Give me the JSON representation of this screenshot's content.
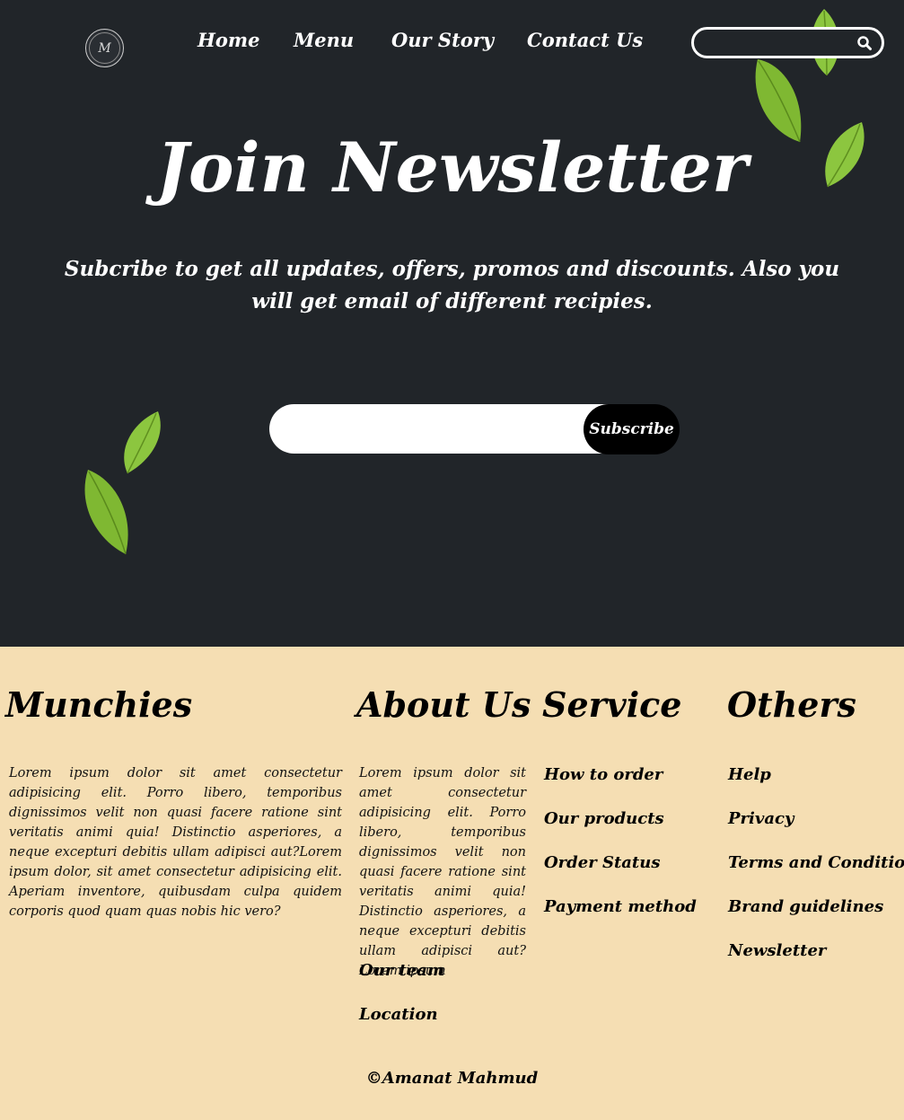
{
  "nav": {
    "logo_text": "M",
    "items": [
      {
        "label": "Home"
      },
      {
        "label": "Menu"
      },
      {
        "label": "Our Story"
      },
      {
        "label": "Contact Us"
      }
    ],
    "search_placeholder": ""
  },
  "hero": {
    "title": "Join Newsletter",
    "subtitle": "Subcribe to get all updates, offers, promos and discounts. Also you will get email of different recipies.",
    "email_placeholder": "",
    "subscribe_label": "Subscribe"
  },
  "footer": {
    "columns": [
      {
        "title": "Munchies",
        "text": "Lorem ipsum dolor sit amet consectetur adipisicing elit. Porro libero, temporibus dignissimos velit non quasi facere ratione sint veritatis animi quia! Distinctio asperiores, a neque excepturi debitis ullam adipisci aut?Lorem ipsum dolor, sit amet consectetur adipisicing elit. Aperiam inventore, quibusdam culpa quidem corporis quod quam quas nobis hic vero?"
      },
      {
        "title": "About Us",
        "text": "Lorem ipsum dolor sit amet consectetur adipisicing elit. Porro libero, temporibus dignissimos velit non quasi facere ratione sint veritatis animi quia! Distinctio asperiores, a neque excepturi debitis ullam adipisci aut? Lorem ipsum",
        "links": [
          "Our team",
          "Location"
        ]
      },
      {
        "title": "Service",
        "links": [
          "How to order",
          "Our products",
          "Order Status",
          "Payment method"
        ]
      },
      {
        "title": "Others",
        "links": [
          "Help",
          "Privacy",
          "Terms and Condition",
          "Brand guidelines",
          "Newsletter"
        ]
      }
    ],
    "copyright": "©Amanat Mahmud"
  },
  "colors": {
    "hero_bg": "#212529",
    "footer_bg": "#f5deb3",
    "leaf": "#8cc63f",
    "button": "#000000"
  }
}
